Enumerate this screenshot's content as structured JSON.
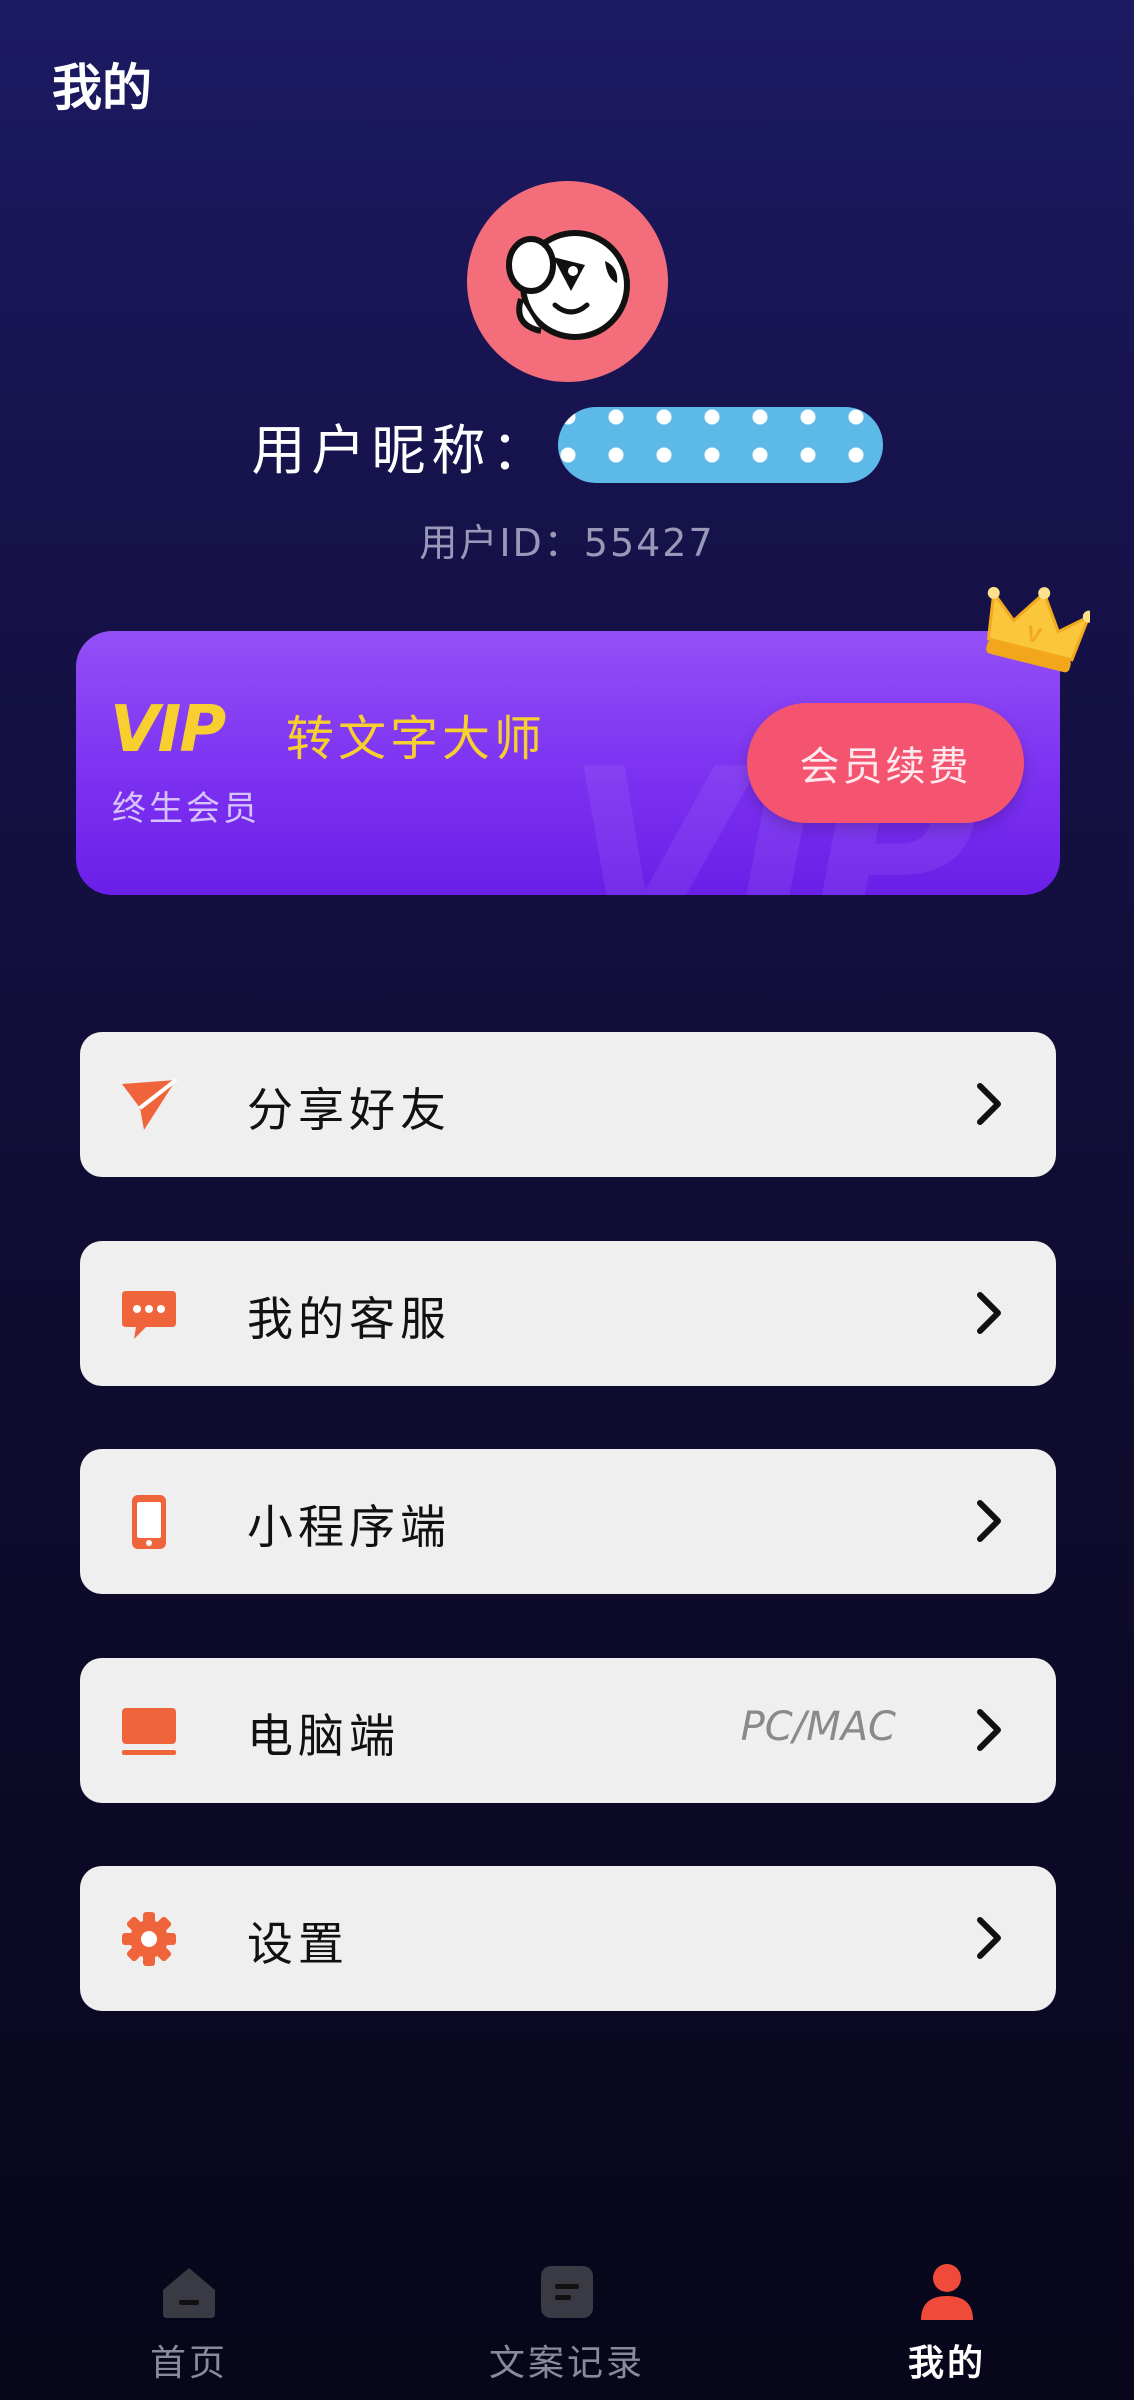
{
  "header": {
    "title": "我的"
  },
  "profile": {
    "nickname_label": "用户昵称：",
    "user_id_label": "用户ID：55427"
  },
  "vip_card": {
    "logo": "VIP",
    "app_name": "转文字大师",
    "membership": "终生会员",
    "renew_button": "会员续费",
    "watermark": "VIP"
  },
  "menu": [
    {
      "label": "分享好友",
      "icon": "send-icon"
    },
    {
      "label": "我的客服",
      "icon": "chat-bubble-icon"
    },
    {
      "label": "小程序端",
      "icon": "mobile-phone-icon"
    },
    {
      "label": "电脑端",
      "extra": "PC/MAC",
      "icon": "laptop-icon"
    },
    {
      "label": "设置",
      "icon": "gear-icon"
    }
  ],
  "tabbar": [
    {
      "label": "首页",
      "icon": "home-icon",
      "active": false
    },
    {
      "label": "文案记录",
      "icon": "document-icon",
      "active": false
    },
    {
      "label": "我的",
      "icon": "user-icon",
      "active": true
    }
  ],
  "colors": {
    "accent": "#f4546f",
    "icon_orange": "#f0643c",
    "vip_gold": "#f7cf2f",
    "vip_purple": "#8a43f5"
  }
}
